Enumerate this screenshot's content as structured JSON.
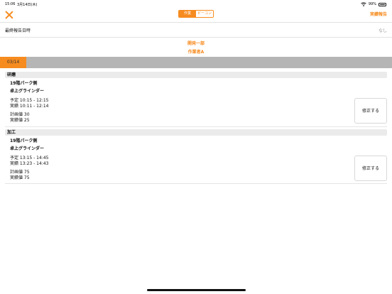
{
  "status_bar": {
    "time": "15:06",
    "date": "3月14日(木)",
    "battery": "99%"
  },
  "nav": {
    "segments": [
      {
        "label": "作業"
      },
      {
        "label": "ビーコン"
      }
    ],
    "report_button": "実績報告"
  },
  "last_report": {
    "label": "最終報告日時",
    "value": "なし"
  },
  "department": "開発一部",
  "worker": "作業者A",
  "date_tab": "03/14",
  "sections": [
    {
      "header": "研磨",
      "place": "19階パーク側",
      "tool": "卓上グラインダー",
      "planned": "予定 10:15 - 12:15",
      "actual": "実績 10:11 - 12:14",
      "plan_value": "計画値 30",
      "actual_value": "実績値 25",
      "fix_label": "修正する"
    },
    {
      "header": "加工",
      "place": "19階パーク側",
      "tool": "卓上グラインダー",
      "planned": "予定 13:15 - 14:45",
      "actual": "実績 13:23 - 14:43",
      "plan_value": "計画値 75",
      "actual_value": "実績値 75",
      "fix_label": "修正する"
    }
  ],
  "colors": {
    "accent": "#f68b1f",
    "tab_bar": "#b5b5b5"
  }
}
